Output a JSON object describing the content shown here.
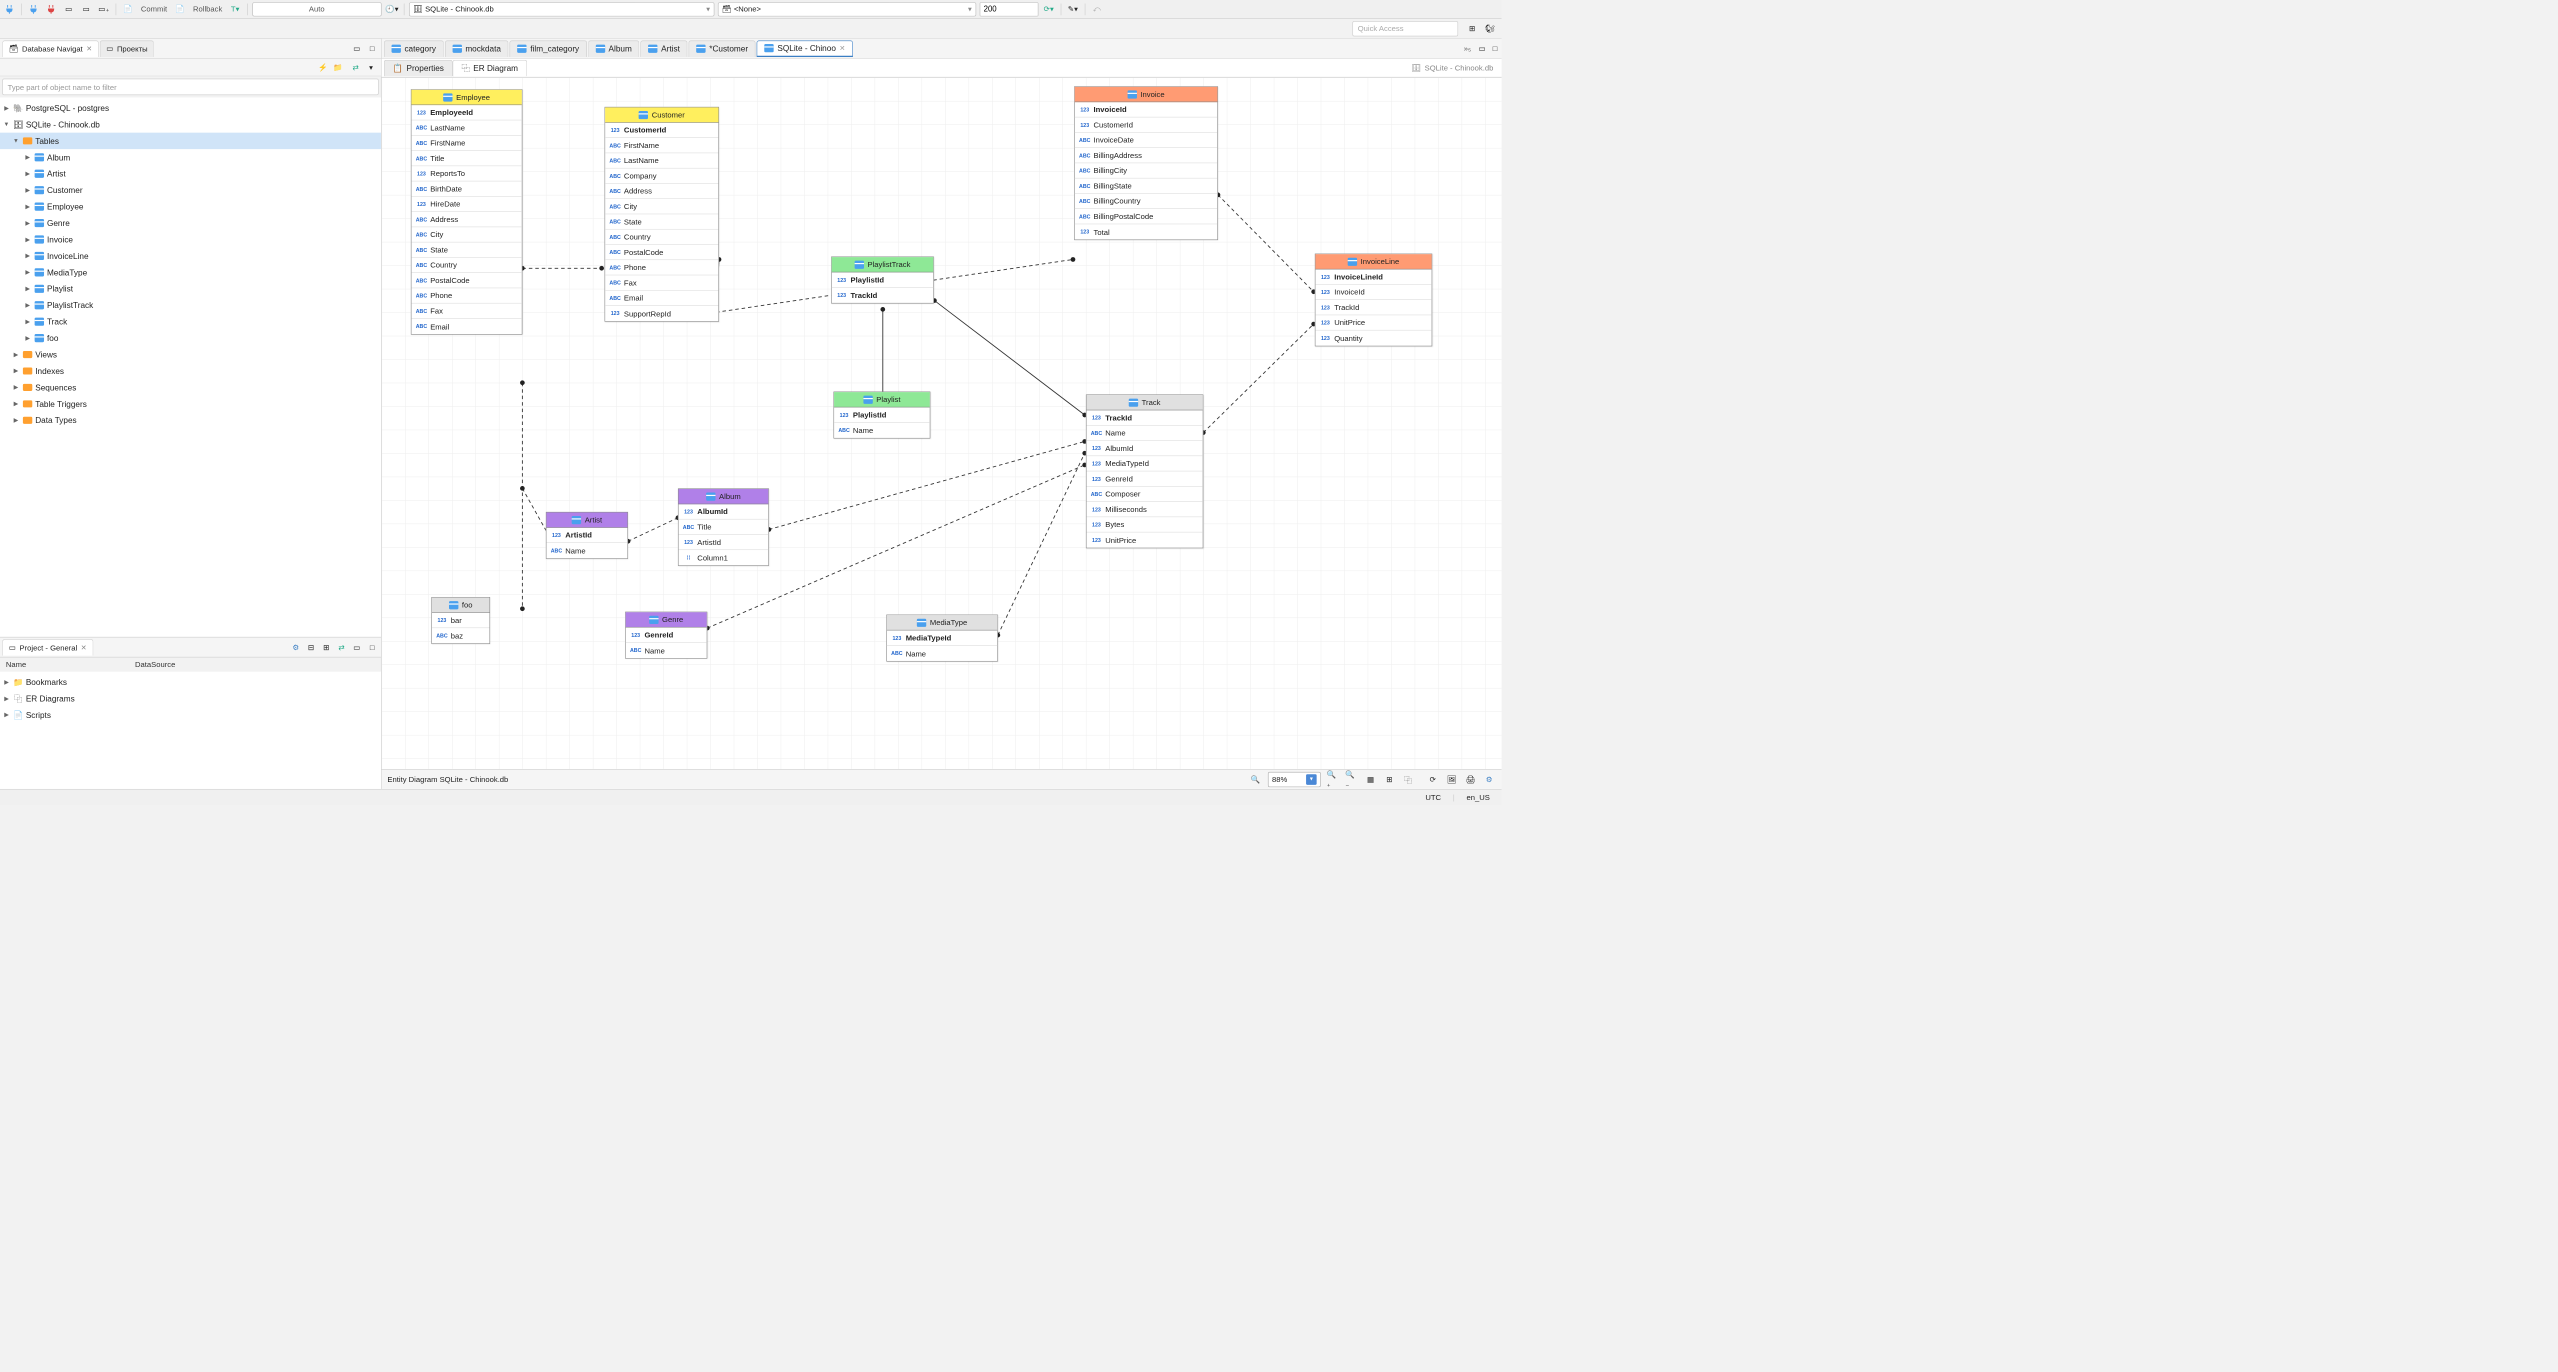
{
  "toolbar": {
    "commit": "Commit",
    "rollback": "Rollback",
    "auto": "Auto",
    "db_selected": "SQLite - Chinook.db",
    "schema_selected": "<None>",
    "limit": "200"
  },
  "quick_access": "Quick Access",
  "nav": {
    "tab1": "Database Navigat",
    "tab2": "Проекты",
    "filter_placeholder": "Type part of object name to filter",
    "tree": {
      "pg": "PostgreSQL - postgres",
      "sqlite": "SQLite - Chinook.db",
      "tables": "Tables",
      "tables_list": [
        "Album",
        "Artist",
        "Customer",
        "Employee",
        "Genre",
        "Invoice",
        "InvoiceLine",
        "MediaType",
        "Playlist",
        "PlaylistTrack",
        "Track",
        "foo"
      ],
      "views": "Views",
      "indexes": "Indexes",
      "sequences": "Sequences",
      "triggers": "Table Triggers",
      "datatypes": "Data Types"
    }
  },
  "project": {
    "title": "Project - General",
    "col1": "Name",
    "col2": "DataSource",
    "items": [
      "Bookmarks",
      "ER Diagrams",
      "Scripts"
    ]
  },
  "editor": {
    "tabs": [
      "category",
      "mockdata",
      "film_category",
      "Album",
      "Artist",
      "*Customer",
      "SQLite - Chinoo"
    ],
    "more": "»₅",
    "subtabs": {
      "properties": "Properties",
      "er": "ER Diagram"
    },
    "breadcrumb": "SQLite - Chinook.db"
  },
  "entities": {
    "Employee": {
      "hdr": "Employee",
      "color": "yellow",
      "pk": "EmployeeId",
      "cols": [
        [
          "ABC",
          "LastName"
        ],
        [
          "ABC",
          "FirstName"
        ],
        [
          "ABC",
          "Title"
        ],
        [
          "123",
          "ReportsTo"
        ],
        [
          "ABC",
          "BirthDate"
        ],
        [
          "123",
          "HireDate"
        ],
        [
          "ABC",
          "Address"
        ],
        [
          "ABC",
          "City"
        ],
        [
          "ABC",
          "State"
        ],
        [
          "ABC",
          "Country"
        ],
        [
          "ABC",
          "PostalCode"
        ],
        [
          "ABC",
          "Phone"
        ],
        [
          "ABC",
          "Fax"
        ],
        [
          "ABC",
          "Email"
        ]
      ]
    },
    "Customer": {
      "hdr": "Customer",
      "color": "yellow",
      "pk": "CustomerId",
      "cols": [
        [
          "ABC",
          "FirstName"
        ],
        [
          "ABC",
          "LastName"
        ],
        [
          "ABC",
          "Company"
        ],
        [
          "ABC",
          "Address"
        ],
        [
          "ABC",
          "City"
        ],
        [
          "ABC",
          "State"
        ],
        [
          "ABC",
          "Country"
        ],
        [
          "ABC",
          "PostalCode"
        ],
        [
          "ABC",
          "Phone"
        ],
        [
          "ABC",
          "Fax"
        ],
        [
          "ABC",
          "Email"
        ],
        [
          "123",
          "SupportRepId"
        ]
      ]
    },
    "Invoice": {
      "hdr": "Invoice",
      "color": "orange",
      "pk": "InvoiceId",
      "cols": [
        [
          "123",
          "CustomerId"
        ],
        [
          "ABC",
          "InvoiceDate"
        ],
        [
          "ABC",
          "BillingAddress"
        ],
        [
          "ABC",
          "BillingCity"
        ],
        [
          "ABC",
          "BillingState"
        ],
        [
          "ABC",
          "BillingCountry"
        ],
        [
          "ABC",
          "BillingPostalCode"
        ],
        [
          "123",
          "Total"
        ]
      ]
    },
    "InvoiceLine": {
      "hdr": "InvoiceLine",
      "color": "orange",
      "pk": "InvoiceLineId",
      "cols": [
        [
          "123",
          "InvoiceId"
        ],
        [
          "123",
          "TrackId"
        ],
        [
          "123",
          "UnitPrice"
        ],
        [
          "123",
          "Quantity"
        ]
      ]
    },
    "PlaylistTrack": {
      "hdr": "PlaylistTrack",
      "color": "green",
      "pk2": [
        "PlaylistId",
        "TrackId"
      ],
      "cols": []
    },
    "Playlist": {
      "hdr": "Playlist",
      "color": "green",
      "pk": "PlaylistId",
      "cols": [
        [
          "ABC",
          "Name"
        ]
      ]
    },
    "Track": {
      "hdr": "Track",
      "color": "gray",
      "pk": "TrackId",
      "cols": [
        [
          "ABC",
          "Name"
        ],
        [
          "123",
          "AlbumId"
        ],
        [
          "123",
          "MediaTypeId"
        ],
        [
          "123",
          "GenreId"
        ],
        [
          "ABC",
          "Composer"
        ],
        [
          "123",
          "Milliseconds"
        ],
        [
          "123",
          "Bytes"
        ],
        [
          "123",
          "UnitPrice"
        ]
      ]
    },
    "Album": {
      "hdr": "Album",
      "color": "purple",
      "pk": "AlbumId",
      "cols": [
        [
          "ABC",
          "Title"
        ],
        [
          "123",
          "ArtistId"
        ],
        [
          "⁞⁞",
          "Column1"
        ]
      ]
    },
    "Artist": {
      "hdr": "Artist",
      "color": "purple",
      "pk": "ArtistId",
      "cols": [
        [
          "ABC",
          "Name"
        ]
      ]
    },
    "Genre": {
      "hdr": "Genre",
      "color": "purple",
      "pk": "GenreId",
      "cols": [
        [
          "ABC",
          "Name"
        ]
      ]
    },
    "MediaType": {
      "hdr": "MediaType",
      "color": "gray",
      "pk": "MediaTypeId",
      "cols": [
        [
          "ABC",
          "Name"
        ]
      ]
    },
    "foo": {
      "hdr": "foo",
      "color": "gray",
      "pk": null,
      "cols": [
        [
          "123",
          "bar"
        ],
        [
          "ABC",
          "baz"
        ]
      ]
    }
  },
  "statusbar": {
    "text": "Entity Diagram SQLite - Chinook.db",
    "zoom": "88%"
  },
  "footer": {
    "tz": "UTC",
    "locale": "en_US"
  }
}
